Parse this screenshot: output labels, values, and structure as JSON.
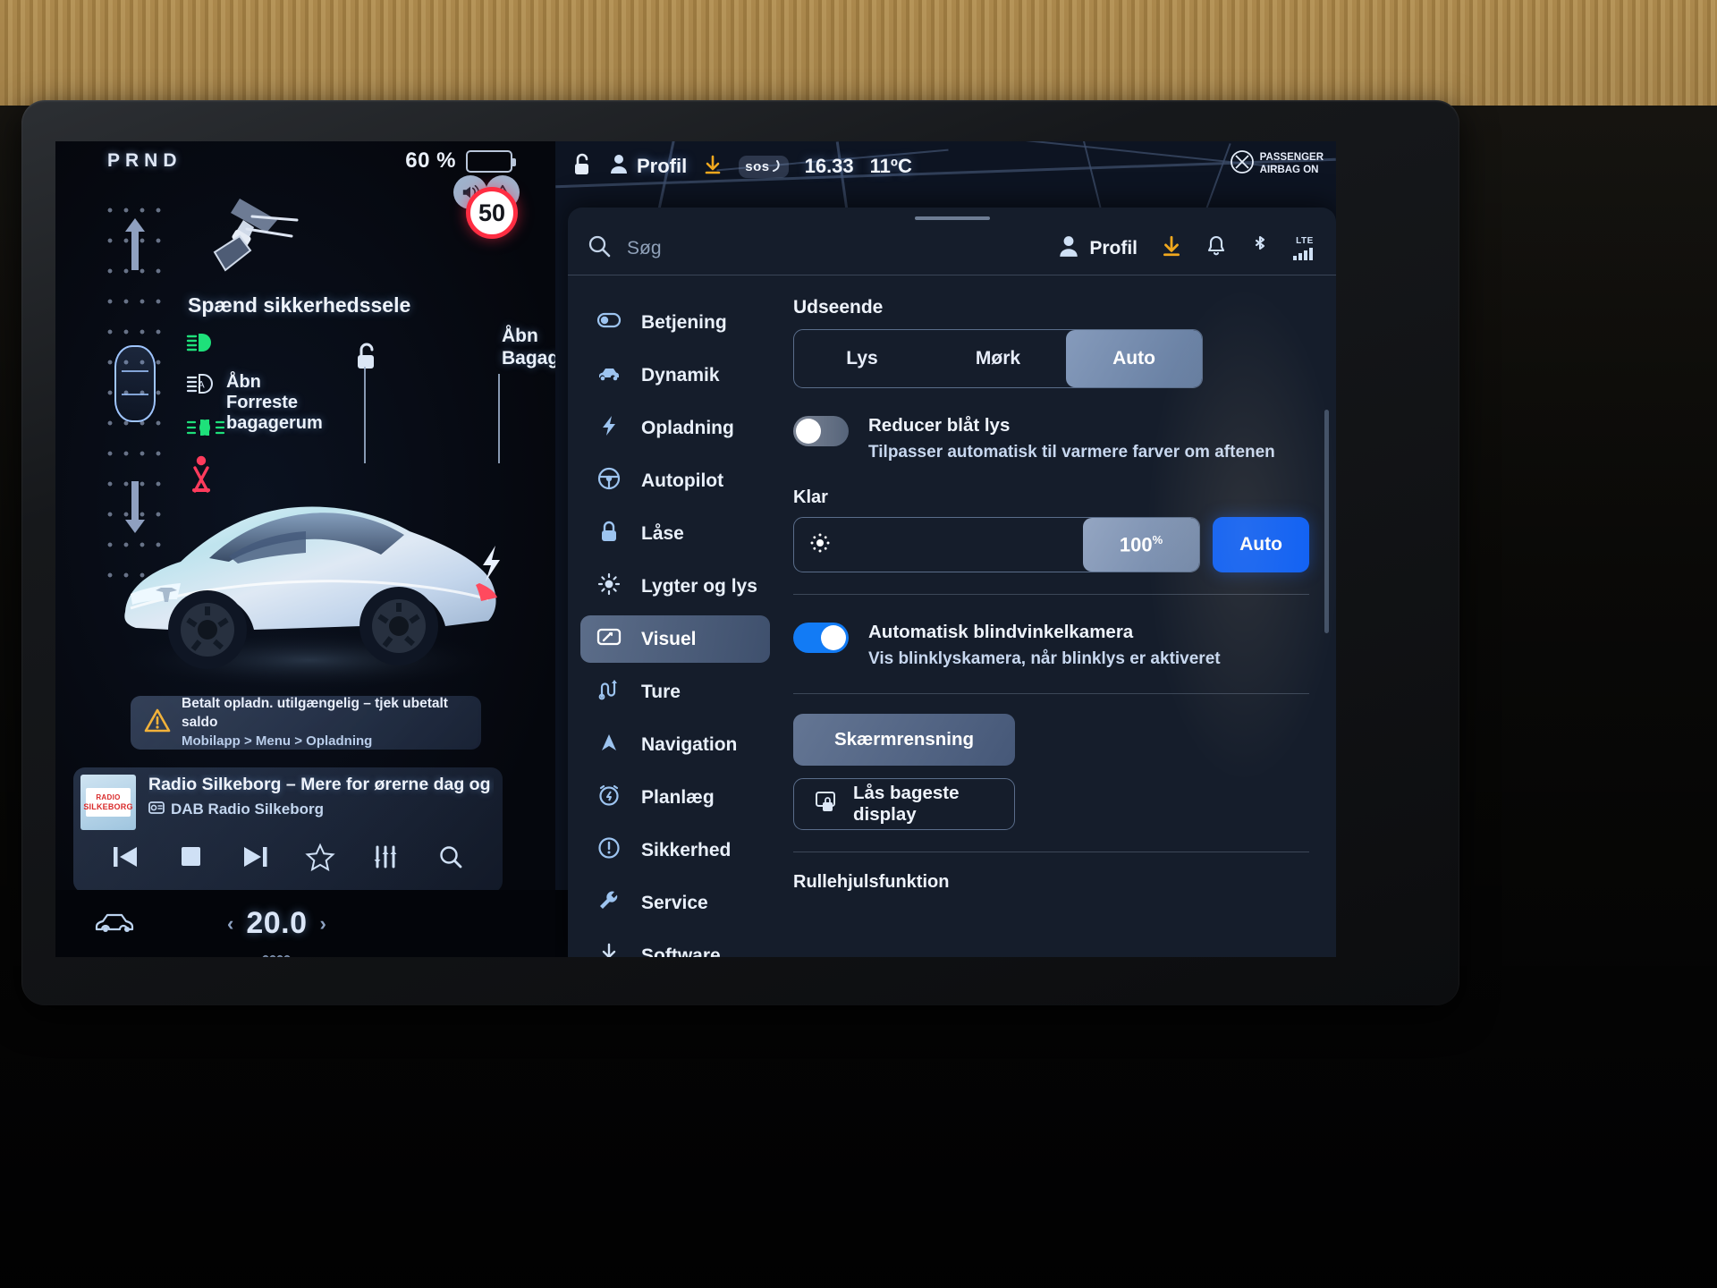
{
  "driver": {
    "gear_indicator": "PRND",
    "battery_percent": "60 %",
    "speed_limit": "50",
    "belt_warning": "Spænd sikkerhedssele",
    "tell_auto_label": "Åbn\nForreste\nbagagerum",
    "frunk_label_line1": "Åbn",
    "frunk_label_line2": "Forreste",
    "frunk_label_line3": "bagagerum",
    "trunk_label_line1": "Åbn",
    "trunk_label_line2": "Bagagerum",
    "notification": {
      "line1": "Betalt opladn. utilgængelig – tjek ubetalt saldo",
      "line2": "Mobilapp > Menu > Opladning"
    },
    "media": {
      "title": "Radio Silkeborg – Mere for ørerne dag og nat",
      "source": "DAB Radio Silkeborg",
      "art_line1": "RADIO",
      "art_line2": "SILKEBORG"
    }
  },
  "topbar": {
    "profile": "Profil",
    "sos": "sos",
    "time": "16.33",
    "temperature": "11ºC",
    "airbag_line1": "PASSENGER",
    "airbag_line2": "AIRBAG ON"
  },
  "sheet_header": {
    "search_placeholder": "Søg",
    "profile": "Profil",
    "lte": "LTE"
  },
  "nav": {
    "items": [
      {
        "label": "Betjening",
        "icon": "toggle-icon"
      },
      {
        "label": "Dynamik",
        "icon": "car-icon"
      },
      {
        "label": "Opladning",
        "icon": "bolt-icon"
      },
      {
        "label": "Autopilot",
        "icon": "steering-wheel-icon"
      },
      {
        "label": "Låse",
        "icon": "lock-icon"
      },
      {
        "label": "Lygter og lys",
        "icon": "sun-icon"
      },
      {
        "label": "Visuel",
        "icon": "display-icon"
      },
      {
        "label": "Ture",
        "icon": "route-icon"
      },
      {
        "label": "Navigation",
        "icon": "navigation-arrow-icon"
      },
      {
        "label": "Planlæg",
        "icon": "alarm-icon"
      },
      {
        "label": "Sikkerhed",
        "icon": "exclamation-circle-icon"
      },
      {
        "label": "Service",
        "icon": "wrench-icon"
      },
      {
        "label": "Software",
        "icon": "download-icon"
      }
    ],
    "active_index": 6
  },
  "content": {
    "appearance_title": "Udseende",
    "theme_options": [
      "Lys",
      "Mørk",
      "Auto"
    ],
    "theme_selected": "Auto",
    "blue_light": {
      "title": "Reducer blåt lys",
      "subtitle": "Tilpasser automatisk til varmere farver om aftenen",
      "enabled": false
    },
    "brightness_label": "Klar",
    "brightness_value": "100",
    "brightness_unit": "%",
    "brightness_auto": "Auto",
    "blind_spot": {
      "title": "Automatisk blindvinkelkamera",
      "subtitle": "Vis blinklyskamera, når blinklys er aktiveret",
      "enabled": true
    },
    "screen_clean": "Skærmrensning",
    "lock_rear_display": "Lås bageste display",
    "scroll_wheel_title": "Rullehjulsfunktion"
  },
  "bottombar": {
    "temperature": "20.0"
  },
  "colors": {
    "accent_blue": "#0b5ef5",
    "toggle_on": "#127bf5",
    "warning_amber": "#f2b23a",
    "green_tell": "#1ee07a",
    "red_tell": "#ff3b5c",
    "speed_red": "#ff2d42"
  }
}
